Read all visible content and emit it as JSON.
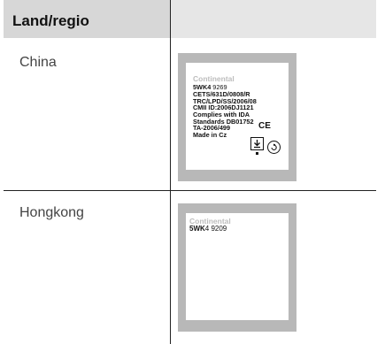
{
  "table": {
    "header": {
      "col1": "Land/regio",
      "col2": ""
    },
    "rows": [
      {
        "country": "China",
        "label": {
          "brand": "Continental",
          "model": "5WK4",
          "model_suffix": " 9269",
          "lines": [
            "CETS/631D/0808/R",
            "TRC/LPD/SS/2006/08",
            "CMII ID:2006DJ1121",
            "Complies with IDA",
            "Standards DB01752",
            "TA-2006/499",
            "Made in Cz"
          ],
          "ce_mark": "CE"
        }
      },
      {
        "country": "Hongkong",
        "label": {
          "brand": "Continental",
          "model": "5WK",
          "model_suffix": "4 9209"
        }
      }
    ]
  }
}
